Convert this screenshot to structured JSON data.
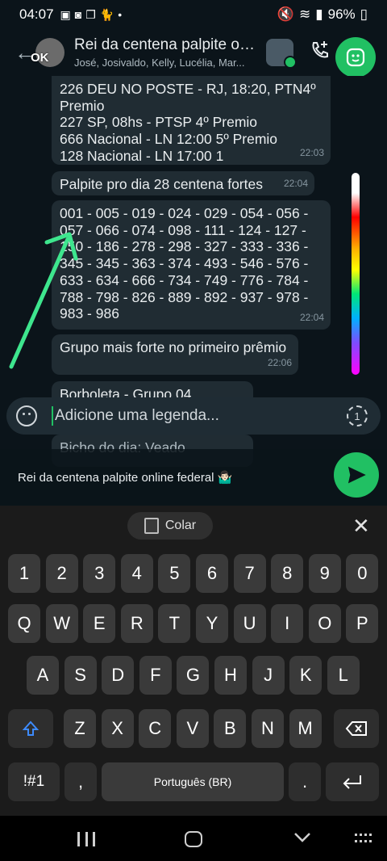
{
  "status_bar": {
    "time": "04:07",
    "battery": "96%"
  },
  "header": {
    "ok_label": "OK",
    "title": "Rei da centena palpite on...",
    "subtitle": "José, Josivaldo, Kelly, Lucélia, Mar..."
  },
  "messages": [
    {
      "text": "226  DEU NO POSTE - RJ, 18:20, PTN4º\nPremio\n227  SP, 08hs - PTSP 4º Premio\n666  Nacional - LN 12:00  5º Premio\n128  Nacional - LN 17:00  1",
      "time": "22:03"
    },
    {
      "text": "Palpite pro dia 28 centena fortes",
      "time": "22:04"
    },
    {
      "text": "001 - 005 - 019 - 024 - 029 - 054 - 056 -\n057 - 066 - 074 - 098 - 111 - 124 - 127 -\n150 - 186 - 278 - 298 - 327 - 333 - 336 -\n345 - 345 - 363 - 374 - 493 - 546 - 576 -\n633 - 634 - 666 - 734 - 749 - 776 - 784 -\n788 - 798 - 826 - 889 - 892 - 937 - 978 -\n983 - 986",
      "time": "22:04"
    },
    {
      "text": "Grupo mais forte no primeiro prêmio",
      "time": "22:06"
    },
    {
      "text": "Borboleta - Grupo 04",
      "time": ""
    },
    {
      "text": "Bicho do dia: Veado",
      "time": ""
    }
  ],
  "caption": {
    "placeholder": "Adicione uma legenda...",
    "view_once": "1"
  },
  "recipient": {
    "name": "Rei da centena palpite online federal 🤷🏻‍♂️"
  },
  "keyboard": {
    "paste_label": "Colar",
    "close_symbol": "✕",
    "row_numbers": [
      "1",
      "2",
      "3",
      "4",
      "5",
      "6",
      "7",
      "8",
      "9",
      "0"
    ],
    "row1": [
      "Q",
      "W",
      "E",
      "R",
      "T",
      "Y",
      "U",
      "I",
      "O",
      "P"
    ],
    "row2": [
      "A",
      "S",
      "D",
      "F",
      "G",
      "H",
      "J",
      "K",
      "L"
    ],
    "row3": [
      "Z",
      "X",
      "C",
      "V",
      "B",
      "N",
      "M"
    ],
    "symbols": "!#1",
    "comma": ",",
    "space_label": "Português (BR)",
    "period": "."
  },
  "colors": {
    "accent": "#21c063",
    "bubble": "#202c33",
    "background": "#0b141a"
  }
}
